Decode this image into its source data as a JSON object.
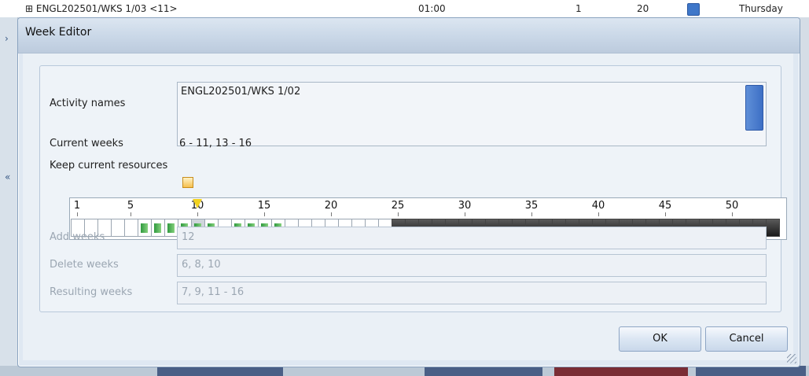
{
  "background": {
    "row_text": "⊞ ENGL202501/WKS 1/03 <11>",
    "time": "01:00",
    "count": "1",
    "capacity": "20",
    "day": "Thursday"
  },
  "dialog": {
    "title": "Week Editor",
    "activity_names_label": "Activity names",
    "activity_names_value": "ENGL202501/WKS 1/02",
    "current_weeks_label": "Current weeks",
    "current_weeks_value": "6 - 11, 13 - 16",
    "keep_resources_label": "Keep current resources",
    "keep_resources_checked": false,
    "week_ruler": {
      "labels": [
        "1",
        "5",
        "10",
        "15",
        "20",
        "25",
        "30",
        "35",
        "40",
        "45",
        "50"
      ],
      "total_weeks": 53,
      "current_marker_week": 10,
      "active_weeks": [
        6,
        7,
        8,
        9,
        10,
        11,
        13,
        14,
        15,
        16
      ],
      "disabled_from_week": 25
    },
    "add_weeks_label": "Add weeks",
    "add_weeks_value": "12",
    "delete_weeks_label": "Delete weeks",
    "delete_weeks_value": "6, 8, 10",
    "resulting_weeks_label": "Resulting weeks",
    "resulting_weeks_value": "7, 9, 11 - 16",
    "ok_label": "OK",
    "cancel_label": "Cancel"
  },
  "colors": {
    "active_week_green": "#3aa046",
    "disabled_week_dark": "#2b2b2b",
    "marker_yellow": "#f2d21f"
  }
}
